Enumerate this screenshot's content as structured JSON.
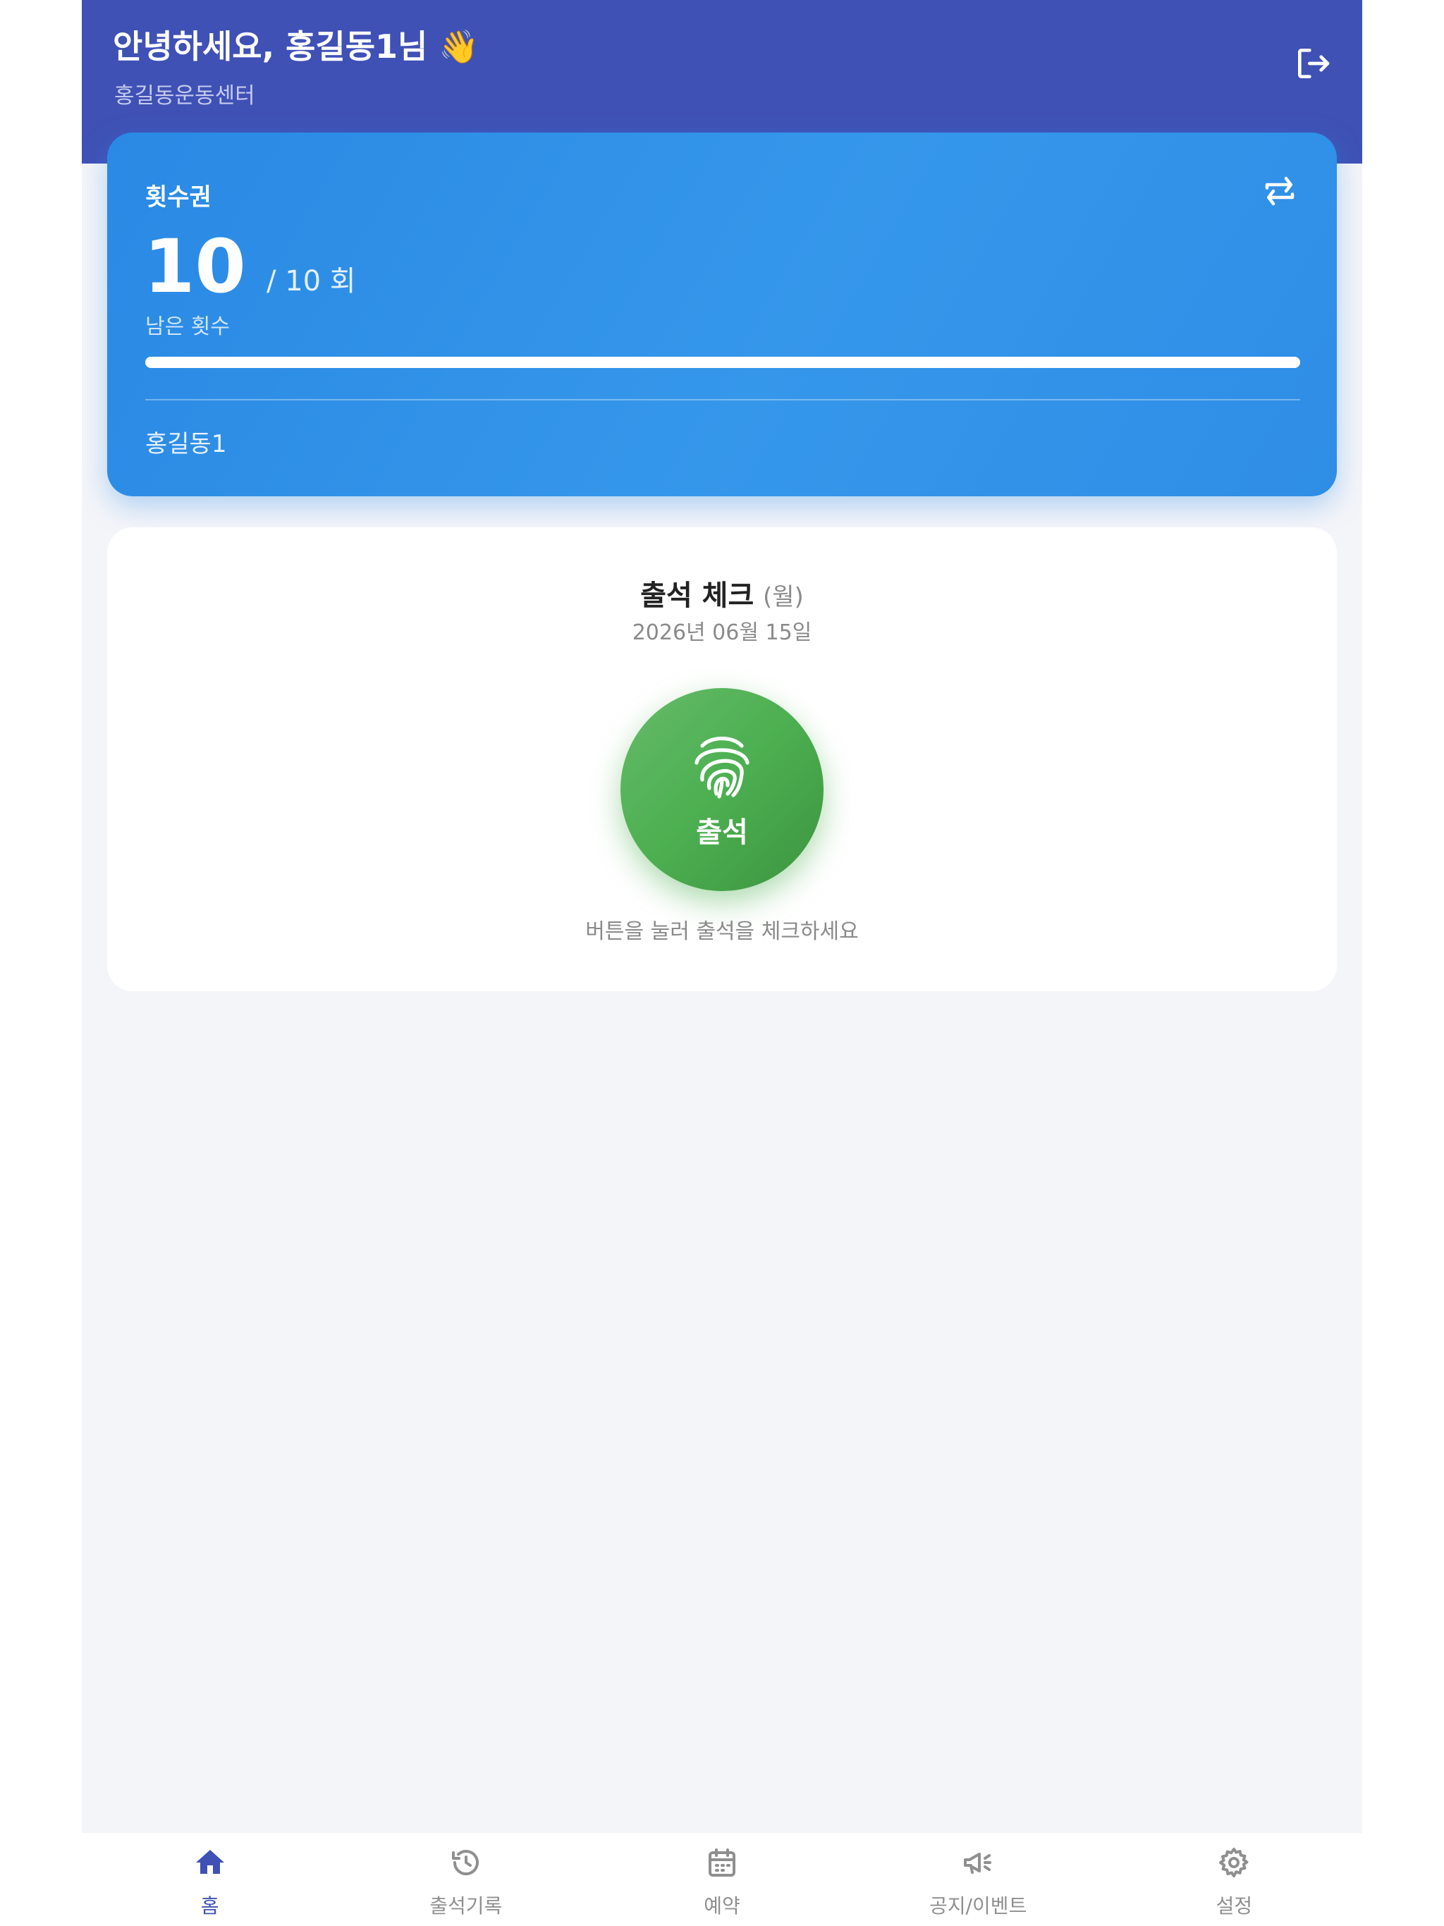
{
  "header": {
    "greeting": "안녕하세요, 홍길동1님 👋",
    "center_name": "홍길동운동센터"
  },
  "pass": {
    "type": "횟수권",
    "remaining": "10",
    "total": "/ 10 회",
    "remaining_label": "남은 횟수",
    "progress": 1.0,
    "member_name": "홍길동1"
  },
  "attendance": {
    "title": "출석 체크",
    "weekday": "(월)",
    "date": "2026년 06월 15일",
    "button_label": "출석",
    "hint": "버튼을 눌러 출석을 체크하세요"
  },
  "nav": {
    "items": [
      {
        "label": "홈",
        "icon": "home-icon",
        "active": true
      },
      {
        "label": "출석기록",
        "icon": "history-icon",
        "active": false
      },
      {
        "label": "예약",
        "icon": "calendar-icon",
        "active": false
      },
      {
        "label": "공지/이벤트",
        "icon": "megaphone-icon",
        "active": false
      },
      {
        "label": "설정",
        "icon": "gear-icon",
        "active": false
      }
    ]
  },
  "colors": {
    "header": "#3f51b5",
    "card": "#2f8de6",
    "attend_button": "#4caf50",
    "active_nav": "#3f51b5"
  }
}
